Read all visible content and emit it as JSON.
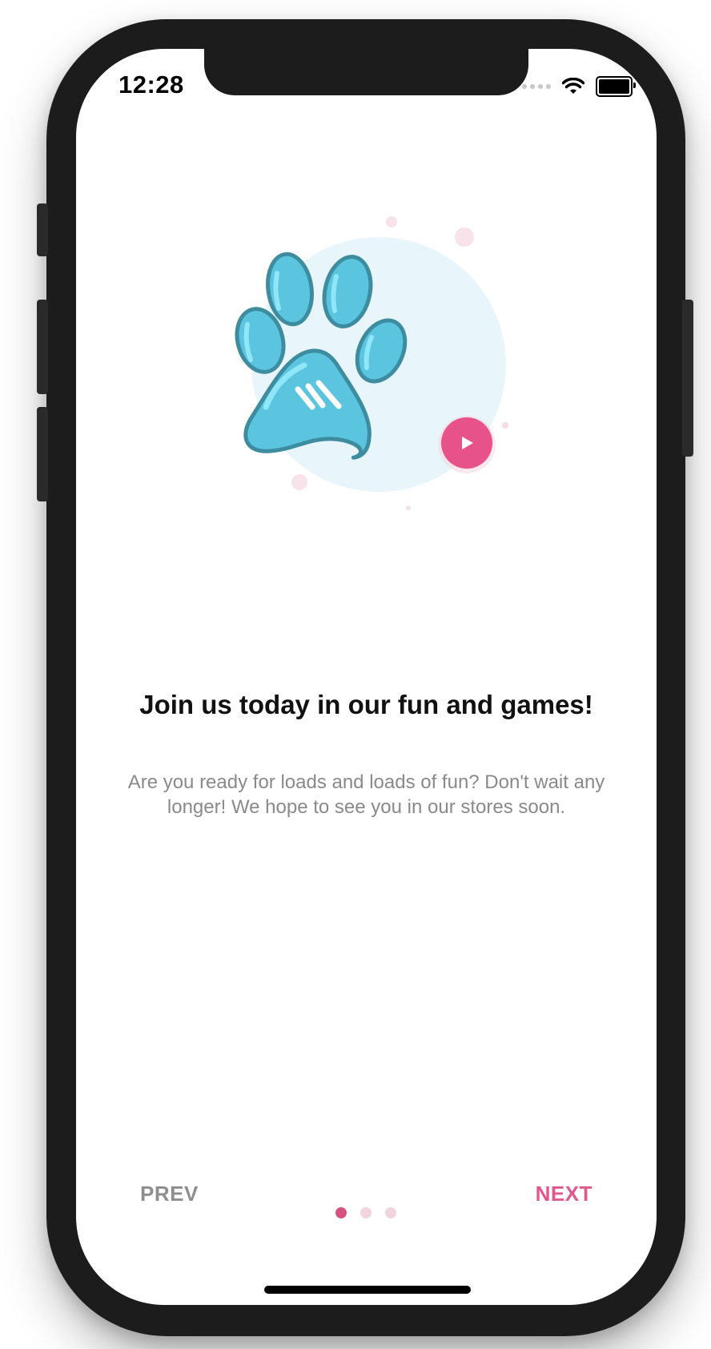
{
  "status_bar": {
    "time": "12:28",
    "icons": [
      "cellular-signal-icon",
      "wifi-icon",
      "battery-icon"
    ]
  },
  "onboarding": {
    "title": "Join us today in our fun and games!",
    "description": "Are you ready for loads and loads of fun? Don't wait any longer! We hope to see you in our stores soon.",
    "illustration_icon": "paw-print-icon",
    "play_icon": "play-icon"
  },
  "navigation": {
    "prev_label": "PREV",
    "next_label": "NEXT",
    "page_count": 3,
    "current_page": 1
  },
  "colors": {
    "accent": "#e0588e",
    "paw_fill": "#5bc5e0",
    "circle_bg": "#e8f6fb",
    "inactive_dot": "#f2d4df",
    "text_secondary": "#8a8a8a"
  }
}
